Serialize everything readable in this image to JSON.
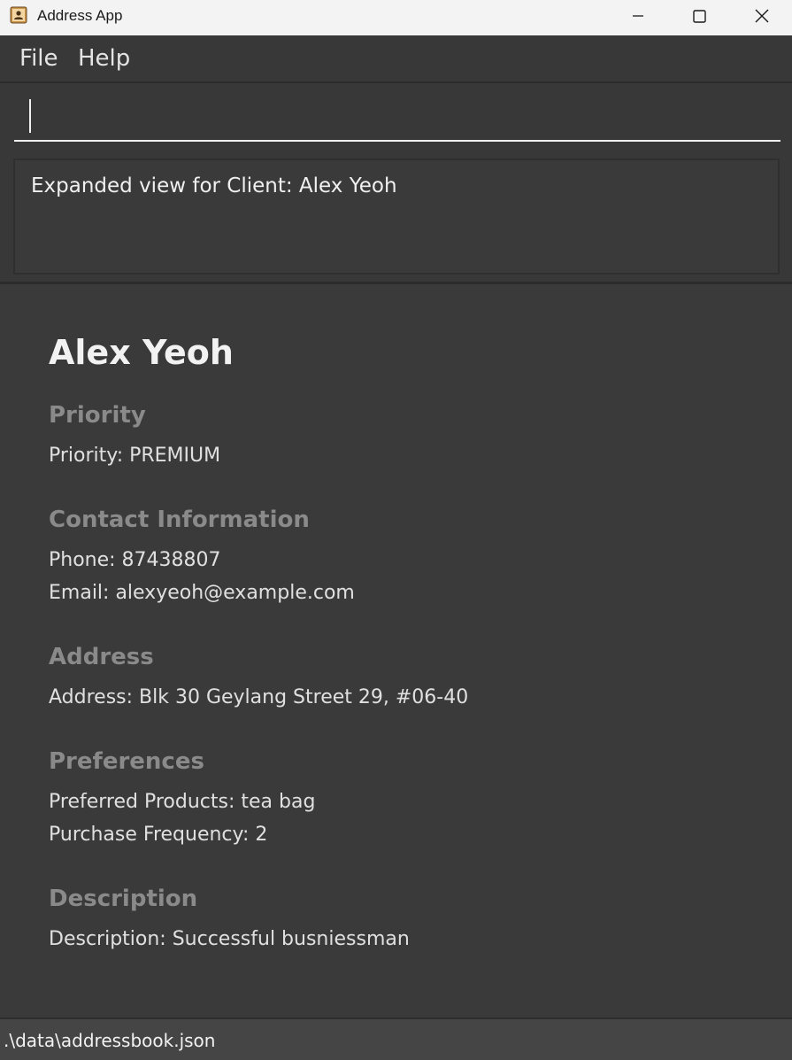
{
  "window": {
    "title": "Address App"
  },
  "menu": {
    "items": [
      "File",
      "Help"
    ]
  },
  "command_box": {
    "value": "",
    "placeholder": ""
  },
  "result_display": {
    "text": "Expanded view for Client: Alex Yeoh"
  },
  "client": {
    "name": "Alex Yeoh",
    "sections": [
      {
        "heading": "Priority",
        "fields": [
          "Priority: PREMIUM"
        ]
      },
      {
        "heading": "Contact Information",
        "fields": [
          "Phone: 87438807",
          "Email: alexyeoh@example.com"
        ]
      },
      {
        "heading": "Address",
        "fields": [
          "Address: Blk 30 Geylang Street 29, #06-40"
        ]
      },
      {
        "heading": "Preferences",
        "fields": [
          "Preferred Products: tea bag",
          "Purchase Frequency: 2"
        ]
      },
      {
        "heading": "Description",
        "fields": [
          "Description: Successful busniessman"
        ]
      }
    ]
  },
  "status_bar": {
    "path": ".\\data\\addressbook.json"
  },
  "icons": {
    "app": "address-book-icon",
    "minimize": "minimize-icon",
    "maximize": "maximize-icon",
    "close": "close-icon"
  },
  "colors": {
    "background": "#383838",
    "heading": "#8a8a8a",
    "text": "#e0e0e0"
  }
}
